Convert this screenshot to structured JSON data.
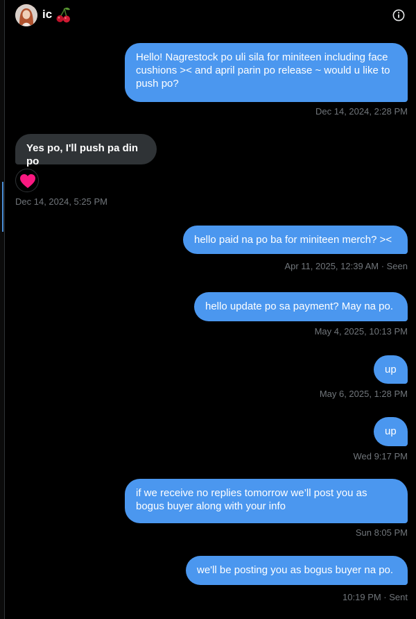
{
  "header": {
    "name": "ic",
    "avatar_icon": "avatar",
    "emoji_icon": "cherry-icon",
    "info_icon": "info-icon"
  },
  "messages": [
    {
      "id": 1,
      "direction": "outgoing",
      "text": "Hello! Nagrestock po uli sila for miniteen including face\ncushions >< and april parin po release ~ would u like to\npush po?",
      "timestamp": "Dec 14, 2024, 2:28 PM"
    },
    {
      "id": 2,
      "direction": "incoming",
      "text": "Yes po, I'll push pa din po",
      "reaction_icon": "heart-icon",
      "timestamp": "Dec 14, 2024, 5:25 PM"
    },
    {
      "id": 3,
      "direction": "outgoing",
      "text": "hello paid na po ba for miniteen merch? ><",
      "timestamp": "Apr 11, 2025, 12:39 AM · Seen"
    },
    {
      "id": 4,
      "direction": "outgoing",
      "text": "hello update po sa payment? May na po.",
      "timestamp": "May 4, 2025, 10:13 PM"
    },
    {
      "id": 5,
      "direction": "outgoing",
      "text": "up",
      "timestamp": "May 6, 2025, 1:28 PM"
    },
    {
      "id": 6,
      "direction": "outgoing",
      "text": "up",
      "timestamp": "Wed 9:17 PM"
    },
    {
      "id": 7,
      "direction": "outgoing",
      "text": "if we receive no replies tomorrow we’ll post you as\nbogus buyer along with your info",
      "timestamp": "Sun 8:05 PM"
    },
    {
      "id": 8,
      "direction": "outgoing",
      "text": "we'll be posting you as bogus buyer na po.",
      "timestamp": "10:19 PM · Sent"
    }
  ],
  "colors": {
    "background": "#000000",
    "outgoing_bubble": "#4b97ef",
    "incoming_bubble": "#2f3336",
    "timestamp": "#71767b",
    "heart": "#f91880"
  }
}
